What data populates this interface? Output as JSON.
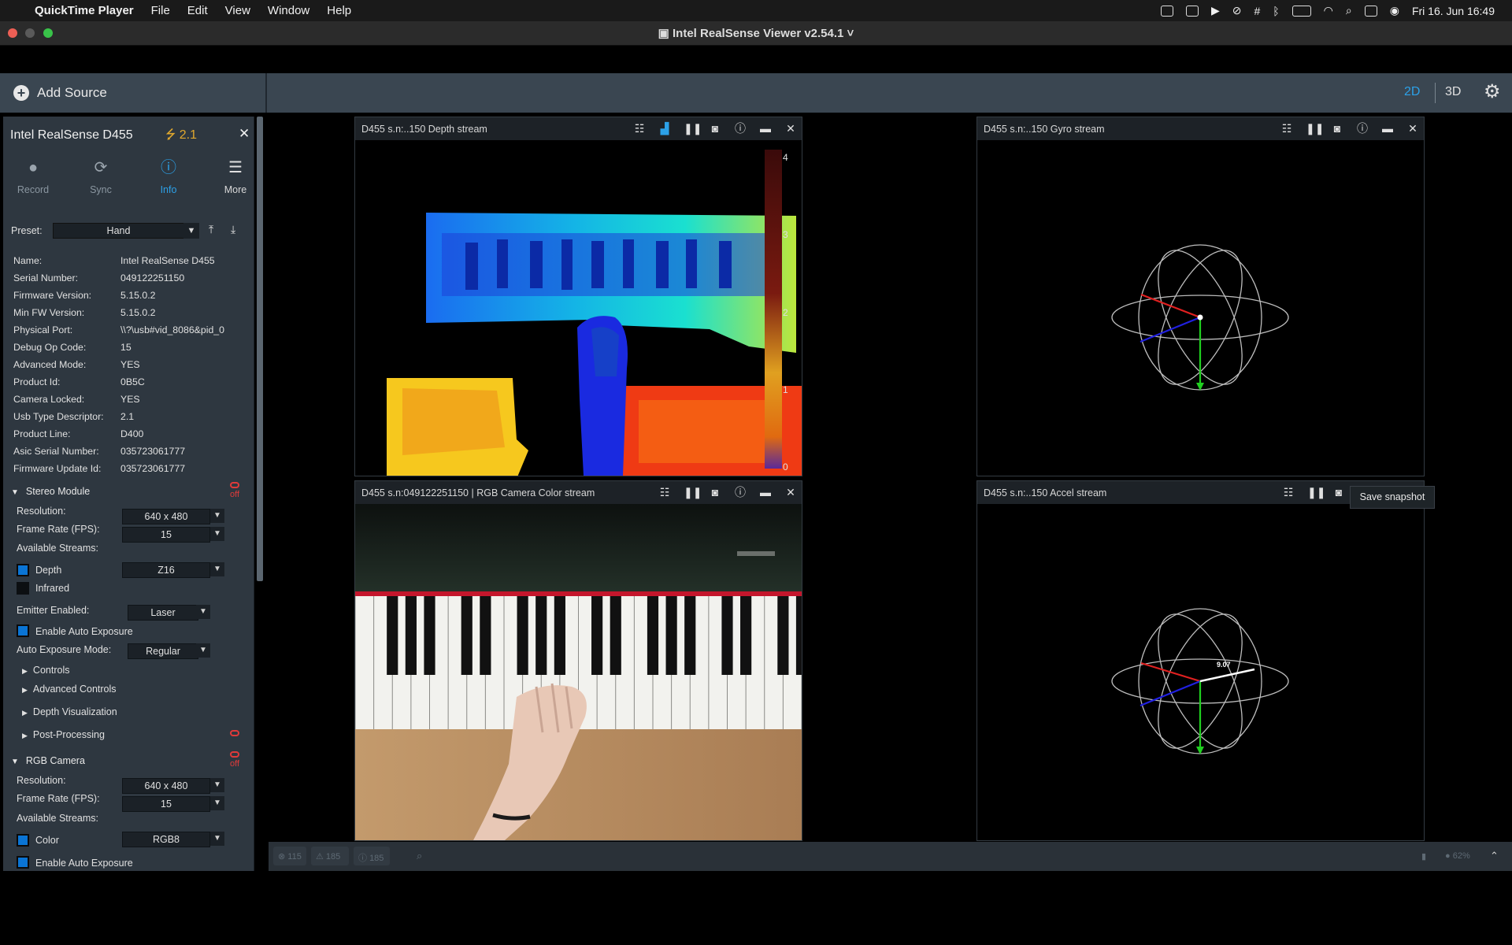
{
  "menubar": {
    "app_name": "QuickTime Player",
    "menus": [
      "File",
      "Edit",
      "View",
      "Window",
      "Help"
    ],
    "datetime": "Fri 16. Jun  16:49"
  },
  "window": {
    "title": "Intel RealSense Viewer v2.54.1"
  },
  "toolbar": {
    "add_source": "Add Source",
    "view_2d": "2D",
    "view_3d": "3D"
  },
  "device": {
    "name": "Intel RealSense D455",
    "usb": "2.1",
    "actions": [
      {
        "label": "Record",
        "icon": "record-icon"
      },
      {
        "label": "Sync",
        "icon": "sync-icon"
      },
      {
        "label": "Info",
        "icon": "info-icon"
      },
      {
        "label": "More",
        "icon": "menu-icon"
      }
    ],
    "preset_label": "Preset:",
    "preset_value": "Hand",
    "info": [
      {
        "key": "Name:",
        "value": "Intel RealSense D455"
      },
      {
        "key": "Serial Number:",
        "value": "049122251150"
      },
      {
        "key": "Firmware Version:",
        "value": "5.15.0.2"
      },
      {
        "key": "Min FW Version:",
        "value": "5.15.0.2"
      },
      {
        "key": "Physical Port:",
        "value": "\\\\?\\usb#vid_8086&pid_0"
      },
      {
        "key": "Debug Op Code:",
        "value": "15"
      },
      {
        "key": "Advanced Mode:",
        "value": "YES"
      },
      {
        "key": "Product Id:",
        "value": "0B5C"
      },
      {
        "key": "Camera Locked:",
        "value": "YES"
      },
      {
        "key": "Usb Type Descriptor:",
        "value": "2.1"
      },
      {
        "key": "Product Line:",
        "value": "D400"
      },
      {
        "key": "Asic Serial Number:",
        "value": "035723061777"
      },
      {
        "key": "Firmware Update Id:",
        "value": "035723061777"
      }
    ]
  },
  "stereo": {
    "title": "Stereo Module",
    "off": "off",
    "resolution_label": "Resolution:",
    "resolution": "640 x 480",
    "fps_label": "Frame Rate (FPS):",
    "fps": "15",
    "streams_label": "Available Streams:",
    "depth_label": "Depth",
    "depth_format": "Z16",
    "infrared_label": "Infrared",
    "emitter_label": "Emitter Enabled:",
    "emitter": "Laser",
    "auto_exposure_label": "Enable Auto Exposure",
    "ae_mode_label": "Auto Exposure Mode:",
    "ae_mode": "Regular",
    "controls": "Controls",
    "advanced_controls": "Advanced Controls",
    "depth_vis": "Depth Visualization",
    "post_processing": "Post-Processing"
  },
  "rgb": {
    "title": "RGB Camera",
    "off": "off",
    "resolution_label": "Resolution:",
    "resolution": "640 x 480",
    "fps_label": "Frame Rate (FPS):",
    "fps": "15",
    "streams_label": "Available Streams:",
    "color_label": "Color",
    "color_format": "RGB8",
    "auto_exposure_label": "Enable Auto Exposure"
  },
  "streams": {
    "depth": {
      "title": "D455 s.n:..150 Depth stream",
      "scale": [
        "4",
        "3",
        "2",
        "1",
        "0"
      ]
    },
    "gyro": {
      "title": "D455 s.n:..150 Gyro stream"
    },
    "color": {
      "title": "D455 s.n:049122251150 | RGB Camera Color stream"
    },
    "accel": {
      "title": "D455 s.n:..150 Accel stream",
      "value": "9.07",
      "tooltip": "Save snapshot"
    }
  },
  "status": {
    "errors": "115",
    "warnings": "185",
    "info": "185",
    "battery": "62%"
  },
  "colors": {
    "accent": "#2ca1e8",
    "panel": "#3a4651",
    "sidebar": "#2e3740",
    "checkbox": "#0a74d4",
    "off_red": "#e03a3a"
  }
}
